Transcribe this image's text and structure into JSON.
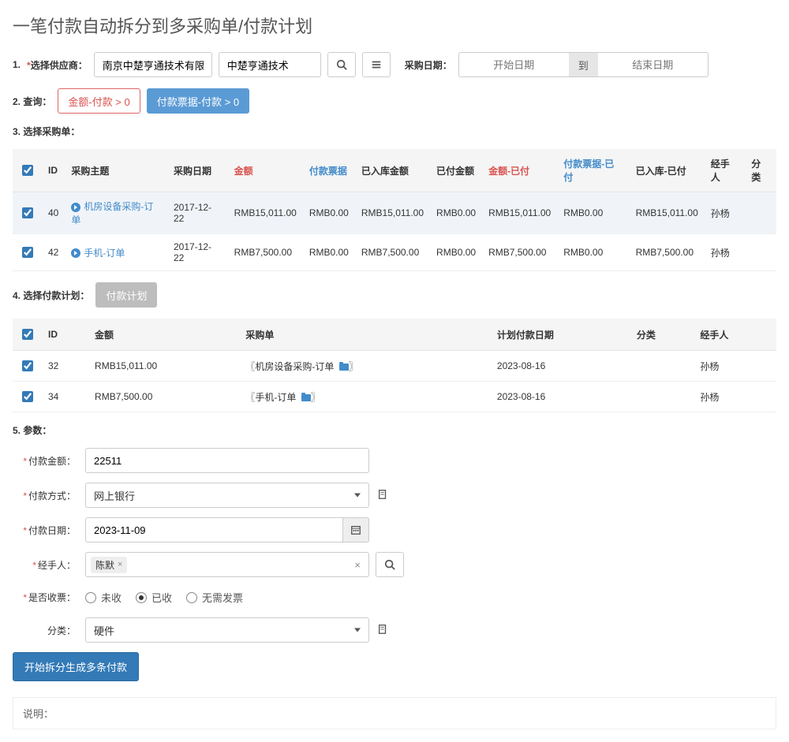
{
  "page_title": "一笔付款自动拆分到多采购单/付款计划",
  "step1": {
    "label": "1.",
    "field_label": "选择供应商：",
    "supplier_value": "南京中楚亨通技术有限公…",
    "supplier_short": "中楚亨通技术",
    "date_label": "采购日期：",
    "start_placeholder": "开始日期",
    "to": "到",
    "end_placeholder": "结束日期"
  },
  "step2": {
    "label": "2. 查询：",
    "btn_amount": "金额-付款 > 0",
    "btn_invoice": "付款票据-付款 > 0"
  },
  "step3": {
    "label": "3. 选择采购单："
  },
  "po_table": {
    "headers": {
      "id": "ID",
      "subject": "采购主题",
      "date": "采购日期",
      "amount": "金额",
      "invoice": "付款票据",
      "in_amount": "已入库金额",
      "paid_amount": "已付金额",
      "amount_paid": "金额-已付",
      "invoice_paid": "付款票据-已付",
      "in_paid": "已入库-已付",
      "handler": "经手人",
      "category": "分类"
    },
    "rows": [
      {
        "id": "40",
        "subject": "机房设备采购-订单",
        "date": "2017-12-22",
        "amount": "RMB15,011.00",
        "invoice": "RMB0.00",
        "in_amount": "RMB15,011.00",
        "paid_amount": "RMB0.00",
        "amount_paid": "RMB15,011.00",
        "invoice_paid": "RMB0.00",
        "in_paid": "RMB15,011.00",
        "handler": "孙杨"
      },
      {
        "id": "42",
        "subject": "手机-订单",
        "date": "2017-12-22",
        "amount": "RMB7,500.00",
        "invoice": "RMB0.00",
        "in_amount": "RMB7,500.00",
        "paid_amount": "RMB0.00",
        "amount_paid": "RMB7,500.00",
        "invoice_paid": "RMB0.00",
        "in_paid": "RMB7,500.00",
        "handler": "孙杨"
      }
    ]
  },
  "step4": {
    "label": "4. 选择付款计划：",
    "btn": "付款计划"
  },
  "plan_table": {
    "headers": {
      "id": "ID",
      "amount": "金额",
      "po": "采购单",
      "plan_date": "计划付款日期",
      "category": "分类",
      "handler": "经手人"
    },
    "rows": [
      {
        "id": "32",
        "amount": "RMB15,011.00",
        "po": "〖机房设备采购-订单",
        "plan_date": "2023-08-16",
        "handler": "孙杨"
      },
      {
        "id": "34",
        "amount": "RMB7,500.00",
        "po": "〖手机-订单",
        "plan_date": "2023-08-16",
        "handler": "孙杨"
      }
    ]
  },
  "po_close": "〗",
  "step5": {
    "label": "5. 参数："
  },
  "form": {
    "amount_label": "付款金额：",
    "amount_value": "22511",
    "method_label": "付款方式：",
    "method_value": "网上银行",
    "date_label": "付款日期：",
    "date_value": "2023-11-09",
    "handler_label": "经手人：",
    "handler_tag": "陈默",
    "invoice_label": "是否收票：",
    "invoice_options": [
      "未收",
      "已收",
      "无需发票"
    ],
    "invoice_selected": 1,
    "category_label": "分类：",
    "category_value": "硬件"
  },
  "submit_label": "开始拆分生成多条付款",
  "notes_label": "说明："
}
